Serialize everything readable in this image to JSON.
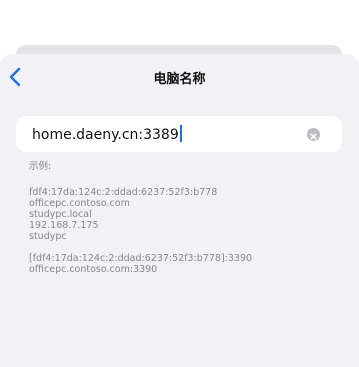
{
  "nav": {
    "title": "电脑名称",
    "back_icon": "chevron-left-icon"
  },
  "field": {
    "value": "home.daeny.cn:3389",
    "clear_icon": "clear-circle-icon"
  },
  "examples": {
    "header": "示例:",
    "group1": [
      "fdf4:17da:124c:2:ddad:6237:52f3:b778",
      "officepc.contoso.com",
      "studypc.local",
      "192.168.7.175",
      "studypc"
    ],
    "group2": [
      "[fdf4:17da:124c:2:ddad:6237:52f3:b778]:3390",
      "officepc.contoso.com:3390"
    ]
  },
  "colors": {
    "accent": "#1a73e8",
    "sheet_bg": "#f2f1f6",
    "hint_text": "#85858b"
  }
}
